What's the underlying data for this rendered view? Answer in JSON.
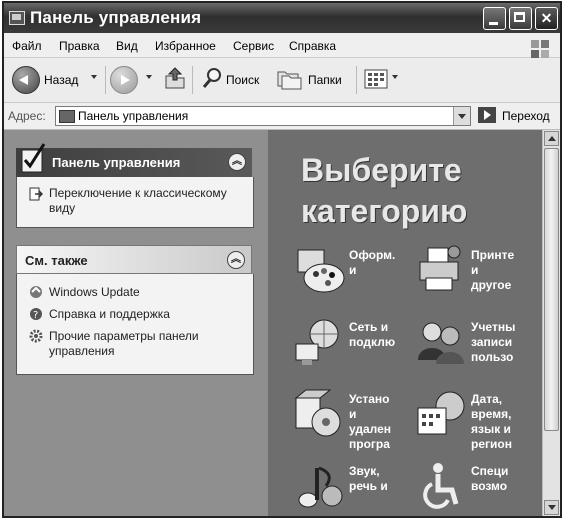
{
  "window": {
    "title": "Панель управления"
  },
  "menu": [
    "Файл",
    "Правка",
    "Вид",
    "Избранное",
    "Сервис",
    "Справка"
  ],
  "toolbar": {
    "back": "Назад",
    "search": "Поиск",
    "folders": "Папки"
  },
  "address": {
    "label": "Адрес:",
    "value": "Панель управления",
    "go": "Переход"
  },
  "left": {
    "panel_title": "Панель управления",
    "switch_link": "Переключение к классическому виду",
    "see_also_title": "См. также",
    "see_also": [
      "Windows Update",
      "Справка и поддержка",
      "Прочие параметры панели управления"
    ]
  },
  "main": {
    "heading_line1": "Выберите",
    "heading_line2": "категорию",
    "categories": [
      "Оформ. и",
      "Принте и другое",
      "Сеть и подклю",
      "Учетны записи пользо",
      "Устано и удален програ",
      "Дата, время, язык и регион",
      "Звук, речь и",
      "Специ возмо"
    ]
  },
  "colors": {
    "title_bar": "#3a3a3a",
    "left_pane": "#8f8f8f",
    "right_pane": "#6e6e6e"
  },
  "icons": [
    "back-arrow",
    "forward-arrow",
    "up-folder",
    "search",
    "folders",
    "views-grid",
    "go-arrow"
  ]
}
